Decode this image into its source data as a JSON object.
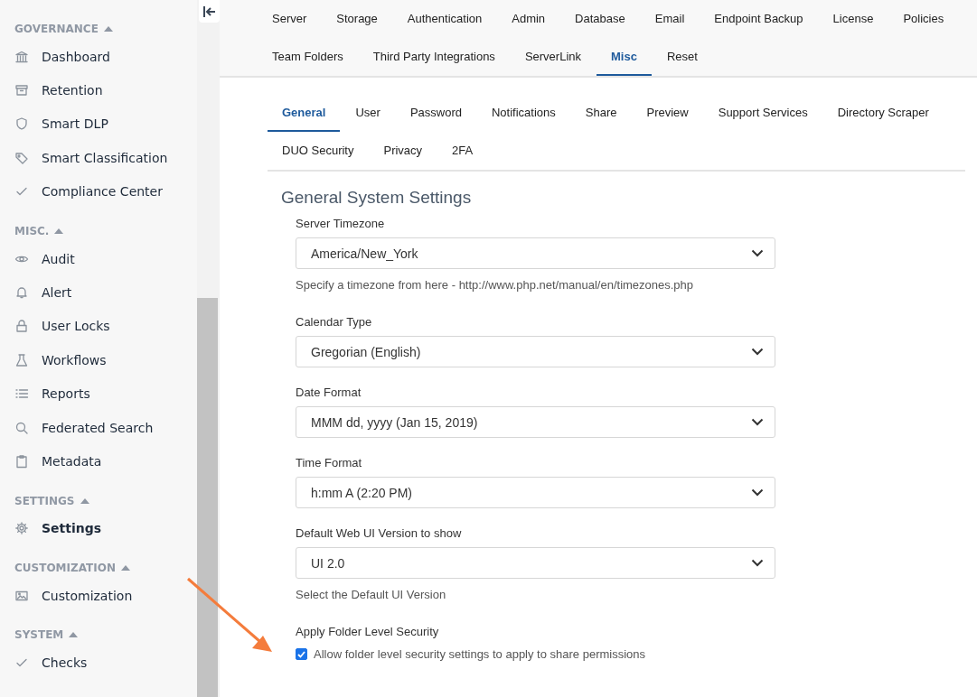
{
  "sidebar": {
    "sections": [
      {
        "title": "GOVERNANCE",
        "expanded": true,
        "items": [
          {
            "label": "Dashboard",
            "selected": false
          },
          {
            "label": "Retention",
            "selected": false
          },
          {
            "label": "Smart DLP",
            "selected": false
          },
          {
            "label": "Smart Classification",
            "selected": false
          },
          {
            "label": "Compliance Center",
            "selected": false
          }
        ]
      },
      {
        "title": "MISC.",
        "expanded": true,
        "items": [
          {
            "label": "Audit",
            "selected": false
          },
          {
            "label": "Alert",
            "selected": false
          },
          {
            "label": "User Locks",
            "selected": false
          },
          {
            "label": "Workflows",
            "selected": false
          },
          {
            "label": "Reports",
            "selected": false
          },
          {
            "label": "Federated Search",
            "selected": false
          },
          {
            "label": "Metadata",
            "selected": false
          }
        ]
      },
      {
        "title": "SETTINGS",
        "expanded": true,
        "items": [
          {
            "label": "Settings",
            "selected": true
          }
        ]
      },
      {
        "title": "CUSTOMIZATION",
        "expanded": true,
        "items": [
          {
            "label": "Customization",
            "selected": false
          }
        ]
      },
      {
        "title": "SYSTEM",
        "expanded": true,
        "items": [
          {
            "label": "Checks",
            "selected": false
          }
        ]
      }
    ]
  },
  "top_tabs": [
    [
      {
        "label": "Server",
        "selected": false
      },
      {
        "label": "Storage",
        "selected": false
      },
      {
        "label": "Authentication",
        "selected": false
      },
      {
        "label": "Admin",
        "selected": false
      },
      {
        "label": "Database",
        "selected": false
      },
      {
        "label": "Email",
        "selected": false
      },
      {
        "label": "Endpoint Backup",
        "selected": false
      },
      {
        "label": "License",
        "selected": false
      },
      {
        "label": "Policies",
        "selected": false
      }
    ],
    [
      {
        "label": "Team Folders",
        "selected": false
      },
      {
        "label": "Third Party Integrations",
        "selected": false
      },
      {
        "label": "ServerLink",
        "selected": false
      },
      {
        "label": "Misc",
        "selected": true
      },
      {
        "label": "Reset",
        "selected": false
      }
    ]
  ],
  "sub_tabs": [
    [
      {
        "label": "General",
        "selected": true
      },
      {
        "label": "User",
        "selected": false
      },
      {
        "label": "Password",
        "selected": false
      },
      {
        "label": "Notifications",
        "selected": false
      },
      {
        "label": "Share",
        "selected": false
      },
      {
        "label": "Preview",
        "selected": false
      },
      {
        "label": "Support Services",
        "selected": false
      },
      {
        "label": "Directory Scraper",
        "selected": false
      }
    ],
    [
      {
        "label": "DUO Security",
        "selected": false
      },
      {
        "label": "Privacy",
        "selected": false
      },
      {
        "label": "2FA",
        "selected": false
      }
    ]
  ],
  "form": {
    "title": "General System Settings",
    "fields": [
      {
        "kind": "select",
        "label": "Server Timezone",
        "value": "America/New_York",
        "help": "Specify a timezone from here - http://www.php.net/manual/en/timezones.php"
      },
      {
        "kind": "select",
        "label": "Calendar Type",
        "value": "Gregorian (English)"
      },
      {
        "kind": "select",
        "label": "Date Format",
        "value": "MMM dd, yyyy (Jan 15, 2019)"
      },
      {
        "kind": "select",
        "label": "Time Format",
        "value": "h:mm A (2:20 PM)"
      },
      {
        "kind": "select",
        "label": "Default Web UI Version to show",
        "value": "UI 2.0",
        "help": "Select the Default UI Version"
      },
      {
        "kind": "checkbox",
        "label": "Apply Folder Level Security",
        "text": "Allow folder level security settings to apply to share permissions",
        "checked": true
      }
    ]
  }
}
